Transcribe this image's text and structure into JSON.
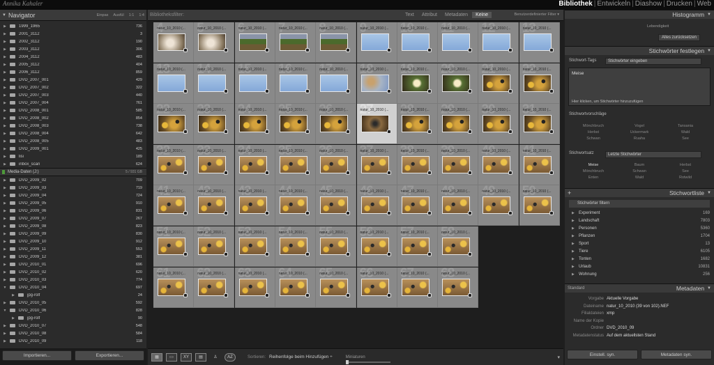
{
  "identity_plate": "Annika Kahaler",
  "modules": [
    "Bibliothek",
    "Entwickeln",
    "Diashow",
    "Drucken",
    "Web"
  ],
  "active_module": "Bibliothek",
  "navigator": {
    "title": "Navigator",
    "zoom": [
      "Einpas",
      "Ausfül",
      "1:1",
      "1:4"
    ]
  },
  "folders": [
    {
      "name": "1999_1965",
      "count": "736"
    },
    {
      "name": "2001_3112",
      "count": "3"
    },
    {
      "name": "2002_3112",
      "count": "190"
    },
    {
      "name": "2003_3112",
      "count": "306"
    },
    {
      "name": "2004_3112",
      "count": "483"
    },
    {
      "name": "2005_3112",
      "count": "404"
    },
    {
      "name": "2006_3112",
      "count": "859"
    },
    {
      "name": "DVD_2007_001",
      "count": "429"
    },
    {
      "name": "DVD_2007_002",
      "count": "322"
    },
    {
      "name": "DVD_2007_003",
      "count": "440"
    },
    {
      "name": "DVD_2007_004",
      "count": "761"
    },
    {
      "name": "DVD_2008_001",
      "count": "585"
    },
    {
      "name": "DVD_2008_002",
      "count": "854"
    },
    {
      "name": "DVD_2008_003",
      "count": "738"
    },
    {
      "name": "DVD_2008_004",
      "count": "642"
    },
    {
      "name": "DVD_2008_005",
      "count": "483"
    },
    {
      "name": "DVD_2009_001",
      "count": "425"
    },
    {
      "name": "lisi",
      "count": "189"
    },
    {
      "name": "inbox_scan",
      "count": "624"
    }
  ],
  "volume": {
    "name": "Media-Daten (J:)",
    "count": "5 / 931 GB"
  },
  "folders2": [
    {
      "name": "DVD_2009_02",
      "count": "709",
      "sub": false,
      "open": false
    },
    {
      "name": "DVD_2009_03",
      "count": "719",
      "sub": false,
      "open": false
    },
    {
      "name": "DVD_2009_04",
      "count": "724",
      "sub": false,
      "open": false
    },
    {
      "name": "DVD_2009_05",
      "count": "910",
      "sub": false,
      "open": false
    },
    {
      "name": "DVD_2009_06",
      "count": "831",
      "sub": false,
      "open": false
    },
    {
      "name": "DVD_2009_07",
      "count": "267",
      "sub": false,
      "open": false
    },
    {
      "name": "DVD_2009_08",
      "count": "823",
      "sub": false,
      "open": false
    },
    {
      "name": "DVD_2009_09",
      "count": "830",
      "sub": false,
      "open": false
    },
    {
      "name": "DVD_2009_10",
      "count": "912",
      "sub": false,
      "open": false
    },
    {
      "name": "DVD_2009_11",
      "count": "553",
      "sub": false,
      "open": false
    },
    {
      "name": "DVD_2009_12",
      "count": "381",
      "sub": false,
      "open": false
    },
    {
      "name": "DVD_2010_01",
      "count": "696",
      "sub": false,
      "open": false
    },
    {
      "name": "DVD_2010_02",
      "count": "620",
      "sub": false,
      "open": false
    },
    {
      "name": "DVD_2010_03",
      "count": "774",
      "sub": false,
      "open": false
    },
    {
      "name": "DVD_2010_04",
      "count": "697",
      "sub": false,
      "open": true
    },
    {
      "name": "jpg-rolf",
      "count": "24",
      "sub": true,
      "open": false
    },
    {
      "name": "DVD_2010_05",
      "count": "592",
      "sub": false,
      "open": false
    },
    {
      "name": "DVD_2010_06",
      "count": "828",
      "sub": false,
      "open": true
    },
    {
      "name": "jpg-rolf",
      "count": "90",
      "sub": true,
      "open": false
    },
    {
      "name": "DVD_2010_07",
      "count": "548",
      "sub": false,
      "open": false
    },
    {
      "name": "DVD_2010_08",
      "count": "584",
      "sub": false,
      "open": false
    },
    {
      "name": "DVD_2010_09",
      "count": "118",
      "sub": false,
      "open": false
    }
  ],
  "left_buttons": {
    "import": "Importieren...",
    "export": "Exportieren..."
  },
  "filter": {
    "label": "Bibliotheksfilter:",
    "tabs": [
      "Text",
      "Attribut",
      "Metadaten",
      "Keine"
    ],
    "active": "Keine",
    "preset": "Benutzerdefinierter Filter ▾"
  },
  "grid": {
    "columns": 10,
    "label": "natur_10_2010 (...",
    "rows": [
      [
        "bug",
        "bug",
        "grass",
        "grass",
        "grass",
        "sky",
        "sky",
        "sky",
        "sky",
        "sky"
      ],
      [
        "sky",
        "sky",
        "sky",
        "sky",
        "sky",
        "tree",
        "ball",
        "ball",
        "tit",
        "tit"
      ],
      [
        "tit",
        "tit",
        "tit",
        "tit",
        "tit",
        "sel",
        "tit",
        "tit",
        "tit",
        "tit"
      ],
      [
        "tit2",
        "tit2",
        "tit2",
        "tit2",
        "tit2",
        "tit2",
        "tit2",
        "tit2",
        "tit2",
        "tit2"
      ],
      [
        "tit2",
        "tit2",
        "tit2",
        "tit2",
        "tit2",
        "tit2",
        "tit2",
        "tit2",
        "tit2",
        "tit2"
      ],
      [
        "tit2",
        "tit2",
        "tit2",
        "tit2",
        "tit2",
        "tit2",
        "tit2",
        "tit2"
      ],
      [
        "tit2",
        "tit2",
        "tit2",
        "tit2",
        "tit2",
        "tit2",
        "tit2",
        "tit2"
      ]
    ],
    "row_numbers": [
      "4",
      "13",
      "22",
      "32",
      "41",
      "51",
      "61"
    ],
    "selected": {
      "row": 2,
      "col": 5
    }
  },
  "toolbar": {
    "sort_label": "Sortieren:",
    "sort_value": "Reihenfolge beim Hinzufügen ÷",
    "thumbs_label": "Miniaturen",
    "menu": "▾"
  },
  "right": {
    "histogram": "Histogramm",
    "lebendig": "Lebendigkeit",
    "reset": "Alles zurücksetzen",
    "kw_header": "Stichwörter festlegen",
    "kw_tags_label": "Stichwort-Tags",
    "kw_tags_value": "Stichwörter eingeben",
    "kw_text": "Meise",
    "kw_hint": "Hier klicken, um Stichwörter hinzuzufügen",
    "sugg_label": "Stichwortvorschläge",
    "sugg": [
      "Mönchbruch",
      "Vogel",
      "Tansania",
      "Herbst",
      "Uckermark",
      "Wald",
      "Schwan",
      "Ruaha",
      "See"
    ],
    "set_label": "Stichwortsatz",
    "set_value": "Letzte Stichwörter",
    "set": [
      "Meise",
      "Baum",
      "Herbst",
      "Mönchbruch",
      "Schwan",
      "See",
      "Enten",
      "Wald",
      "Rotwild"
    ],
    "kwlist_header": "Stichwortliste",
    "kwlist_filter": "Stichwörter filtern",
    "kwlist": [
      {
        "name": "Experiment",
        "count": "169"
      },
      {
        "name": "Landschaft",
        "count": "7803"
      },
      {
        "name": "Personen",
        "count": "5360"
      },
      {
        "name": "Pflanzen",
        "count": "1704"
      },
      {
        "name": "Sport",
        "count": "13"
      },
      {
        "name": "Tiere",
        "count": "6105"
      },
      {
        "name": "Tonten",
        "count": "1682"
      },
      {
        "name": "Urlaub",
        "count": "10831"
      },
      {
        "name": "Wohnung",
        "count": "256"
      }
    ],
    "meta_header": "Metadaten",
    "meta_preset": "Standard",
    "meta": [
      {
        "k": "Vorgabe",
        "v": "Aktuelle Vorgabe"
      },
      {
        "k": "Dateiname",
        "v": "natur_10_2010 (39 von 102).NEF"
      },
      {
        "k": "Filialdateien",
        "v": "xmp"
      },
      {
        "k": "Name der Kopie",
        "v": ""
      },
      {
        "k": "Ordner",
        "v": "DVD_2010_09"
      },
      {
        "k": "Metadatenstatus",
        "v": "Auf dem aktuellsten Stand"
      }
    ],
    "btn_sync": "Einstell. syn.",
    "btn_meta": "Metadaten syn."
  }
}
